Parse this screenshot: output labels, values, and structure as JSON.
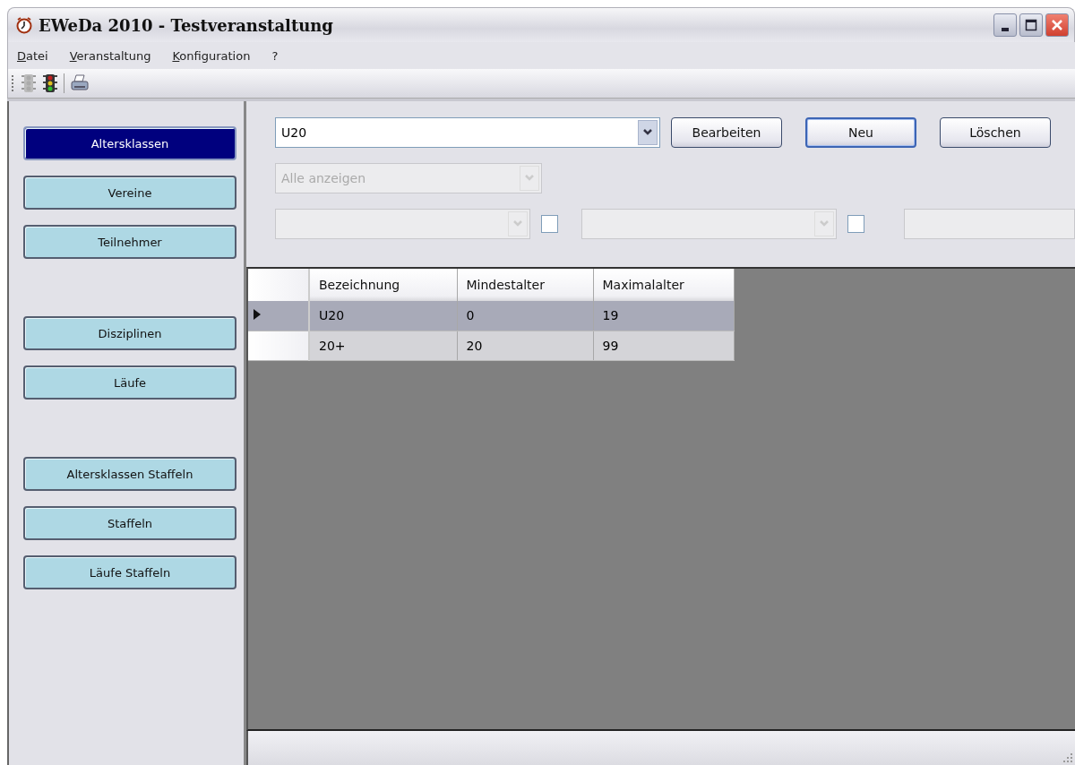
{
  "window": {
    "title": "EWeDa 2010 - Testveranstaltung"
  },
  "menu": [
    {
      "label": "Datei",
      "accelerator": true
    },
    {
      "label": "Veranstaltung",
      "accelerator": true
    },
    {
      "label": "Konfiguration",
      "accelerator": true
    },
    {
      "label": "?",
      "accelerator": false
    }
  ],
  "toolbar": [
    {
      "kind": "traffic-light",
      "disabled": true
    },
    {
      "kind": "traffic-light",
      "disabled": false
    },
    {
      "kind": "separator"
    },
    {
      "kind": "printer",
      "disabled": false
    }
  ],
  "sidebar": {
    "groups": [
      {
        "items": [
          {
            "label": "Altersklassen",
            "selected": true
          },
          {
            "label": "Vereine",
            "selected": false
          },
          {
            "label": "Teilnehmer",
            "selected": false
          }
        ]
      },
      {
        "items": [
          {
            "label": "Disziplinen",
            "selected": false
          },
          {
            "label": "Läufe",
            "selected": false
          }
        ]
      },
      {
        "items": [
          {
            "label": "Altersklassen Staffeln",
            "selected": false
          },
          {
            "label": "Staffeln",
            "selected": false
          },
          {
            "label": "Läufe Staffeln",
            "selected": false
          }
        ]
      }
    ]
  },
  "editor": {
    "combo": {
      "value": "U20"
    },
    "buttons": [
      {
        "label": "Bearbeiten",
        "default": false
      },
      {
        "label": "Neu",
        "default": true
      },
      {
        "label": "Löschen",
        "default": false
      }
    ],
    "filter": {
      "value": "Alle anzeigen",
      "disabled": true
    },
    "filter_row": [
      {
        "kind": "combo",
        "disabled": true
      },
      {
        "kind": "checkbox",
        "checked": false
      },
      {
        "kind": "combo",
        "disabled": true
      },
      {
        "kind": "checkbox",
        "checked": false
      },
      {
        "kind": "field",
        "disabled": true
      }
    ]
  },
  "table": {
    "columns": [
      "Bezeichnung",
      "Mindestalter",
      "Maximalalter"
    ],
    "rows": [
      {
        "cells": [
          "U20",
          "0",
          "19"
        ],
        "selected": true
      },
      {
        "cells": [
          "20+",
          "20",
          "99"
        ],
        "selected": false
      }
    ]
  }
}
